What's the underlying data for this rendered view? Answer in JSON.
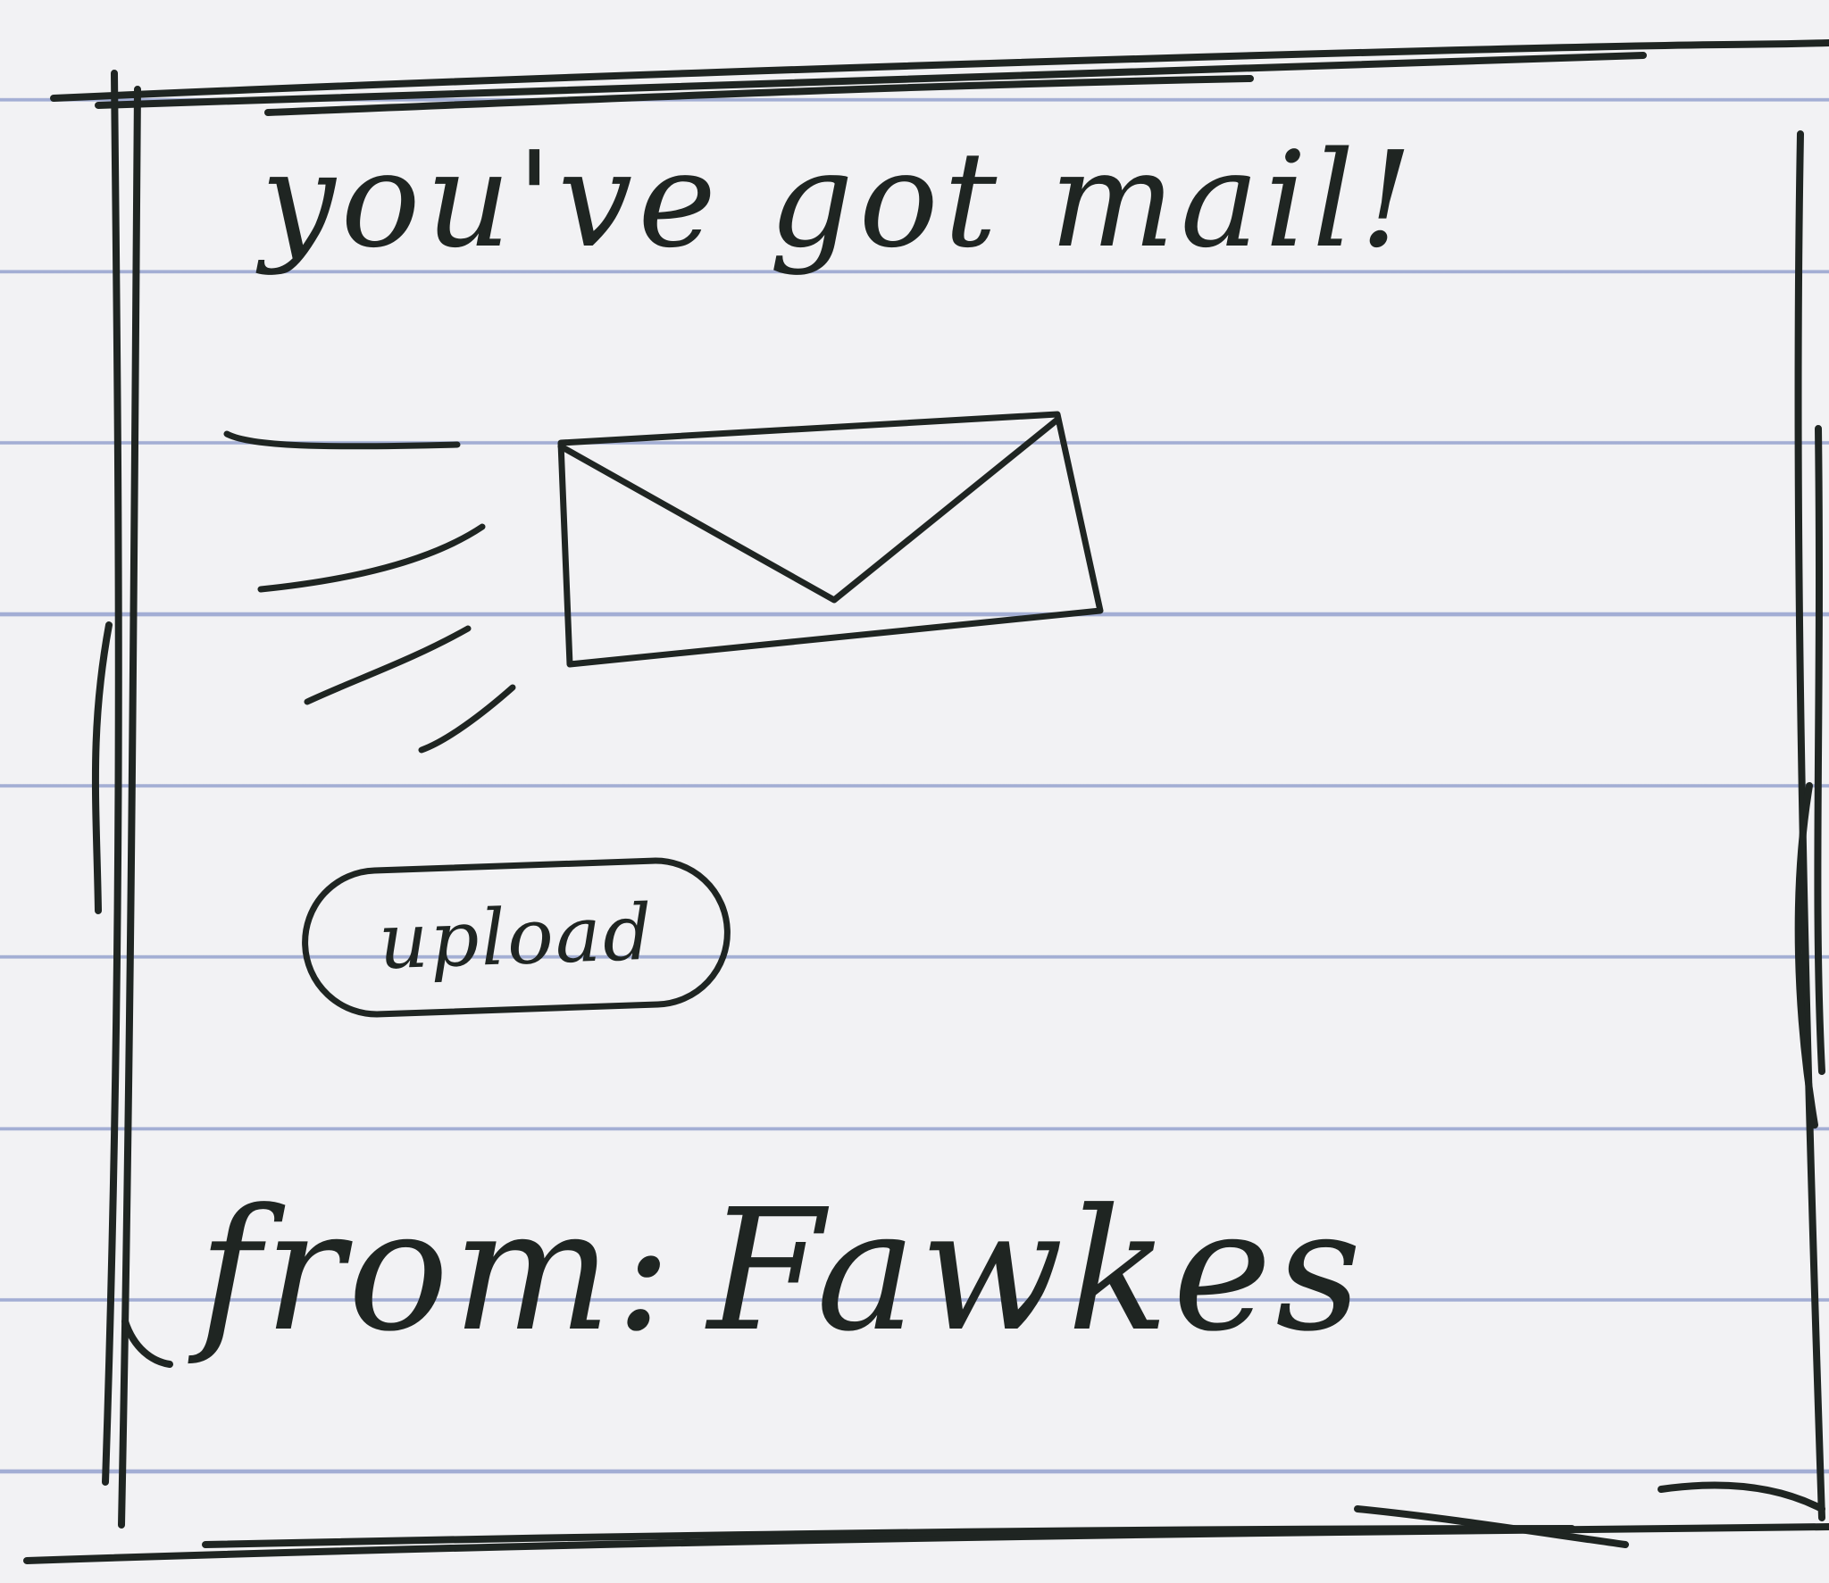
{
  "title": "you've got mail!",
  "upload_button": {
    "label": "upload"
  },
  "sender": {
    "label": "from:",
    "name": "Fawkes"
  },
  "icons": {
    "mail": "envelope-icon",
    "motion": "motion-lines-icon"
  },
  "colors": {
    "ink": "#1f2522",
    "paper": "#f2f2f4",
    "rule_line": "#6276b9"
  }
}
